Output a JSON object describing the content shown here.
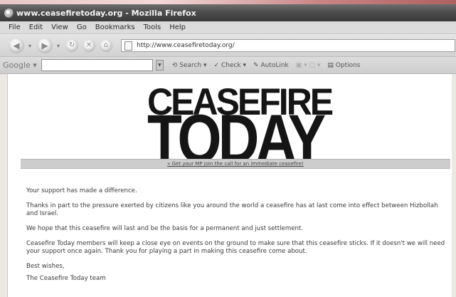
{
  "window": {
    "title": "www.ceasefiretoday.org - Mozilla Firefox"
  },
  "menu": {
    "items": [
      "File",
      "Edit",
      "View",
      "Go",
      "Bookmarks",
      "Tools",
      "Help"
    ]
  },
  "navigation": {
    "url": "http://www.ceasefiretoday.org/"
  },
  "google_toolbar": {
    "logo": "Google",
    "search_label": "Search",
    "check_label": "Check",
    "autolink_label": "AutoLink",
    "options_label": "Options"
  },
  "page": {
    "logo_line1": "CEASEFIRE",
    "logo_line2": "TODAY",
    "banner_link": "» Get your MP join the call for an immediate ceasefire!",
    "paragraphs": [
      "Your support has made a difference.",
      "Thanks in part to the pressure exerted by citizens like you around the world a ceasefire has at last come into effect between Hizbollah and Israel.",
      "We hope that this ceasefire will last and be the basis for a permanent and just settlement.",
      "Ceasefire Today members will keep a close eye on events on the ground to make sure that this ceasefire sticks. If it doesn't we will need your support once again. Thank you for playing a part in making this ceasefire come about.",
      "Best wishes,",
      "The Ceasefire Today team"
    ]
  }
}
